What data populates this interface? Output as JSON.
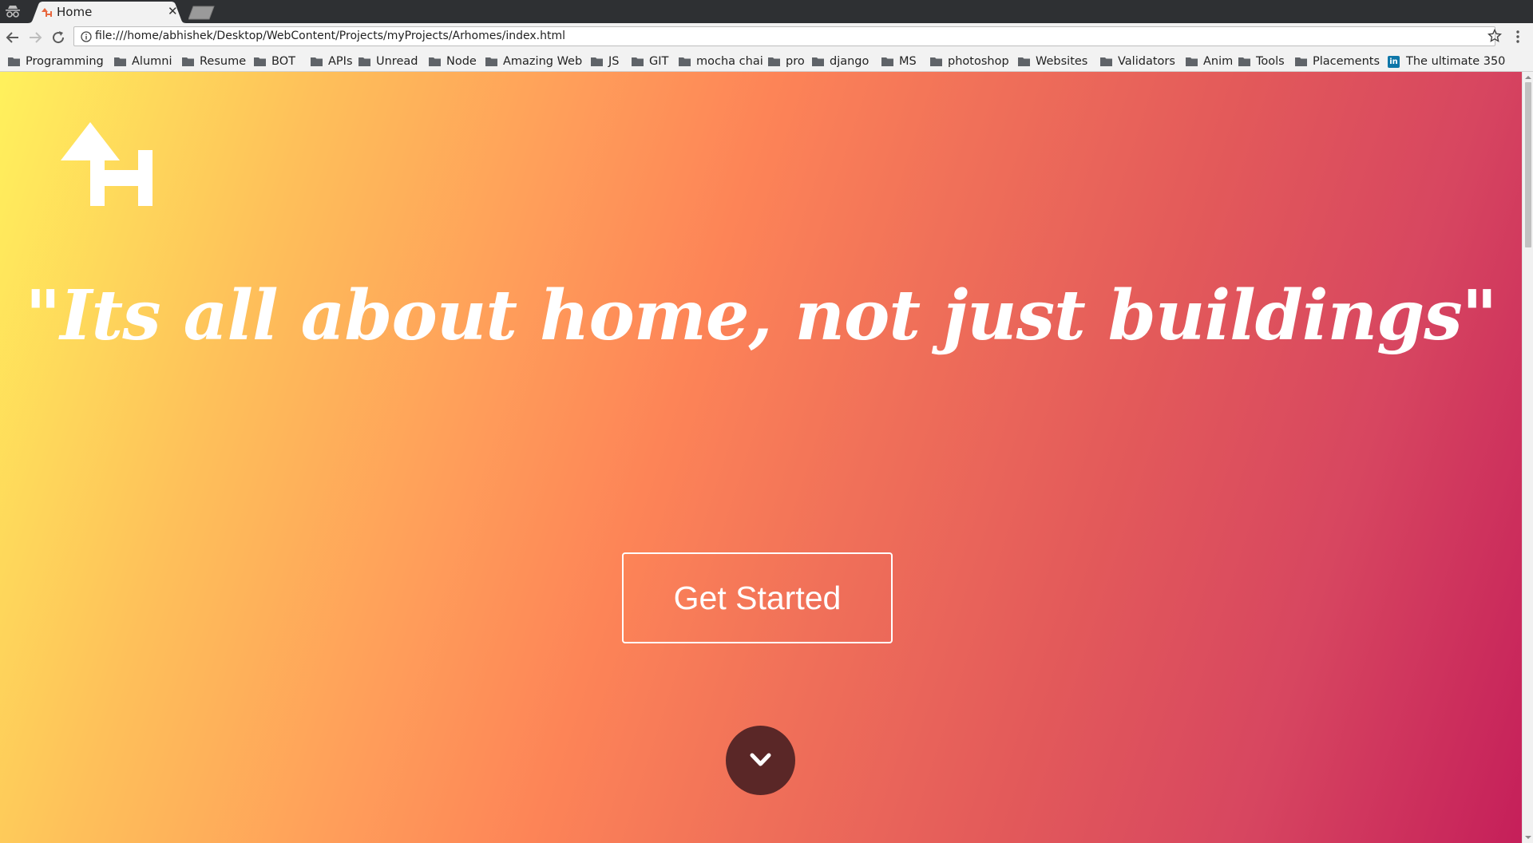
{
  "browser": {
    "tab": {
      "title": "Home"
    },
    "address_bar": {
      "url": "file:///home/abhishek/Desktop/WebContent/Projects/myProjects/Arhomes/index.html"
    },
    "bookmarks": [
      "Programming",
      "Alumni",
      "Resume",
      "BOT",
      "APIs",
      "Unread",
      "Node",
      "Amazing Web",
      "JS",
      "GIT",
      "mocha chai",
      "pro",
      "django",
      "MS",
      "photoshop",
      "Websites",
      "Validators",
      "Anim",
      "Tools",
      "Placements"
    ],
    "linkedin_bookmark": "The ultimate 350"
  },
  "page": {
    "logo_icon": "house-h-logo-icon",
    "quote": "\"Its all about home, not just buildings\"",
    "cta_label": "Get Started",
    "scroll_icon": "chevron-down-icon",
    "colors": {
      "gradient_start": "#fff15c",
      "gradient_mid": "#fd8457",
      "gradient_end": "#c51f5a",
      "scroll_button": "#5a2727",
      "text": "#ffffff"
    }
  }
}
